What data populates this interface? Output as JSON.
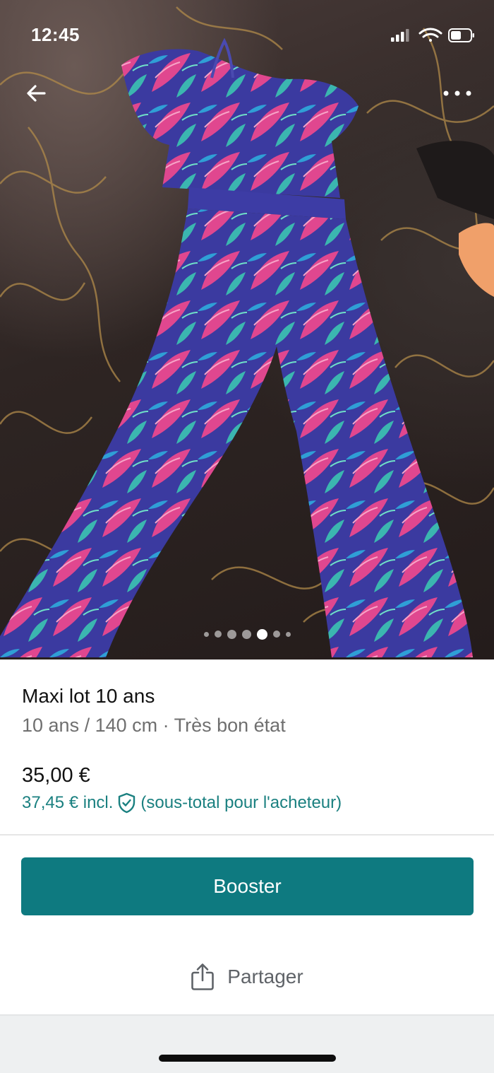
{
  "status_bar": {
    "time": "12:45",
    "icons": [
      "cellular-signal-icon",
      "wifi-icon",
      "battery-icon"
    ]
  },
  "nav": {
    "back_icon": "arrow-left-icon",
    "more_icon": "more-horizontal-icon"
  },
  "gallery": {
    "photo_count": 7,
    "active_index": 4
  },
  "item": {
    "title": "Maxi lot 10 ans",
    "subtitle": "10 ans / 140 cm · Très bon état",
    "price": "35,00 €",
    "price_incl_amount": "37,45 € incl.",
    "price_incl_note": "(sous-total pour l'acheteur)",
    "protection_icon": "shield-check-icon"
  },
  "actions": {
    "booster_label": "Booster",
    "share_label": "Partager",
    "share_icon": "share-icon"
  },
  "colors": {
    "accent": "#0e7a80",
    "link": "#1a8080",
    "muted_text": "#6f6f6f"
  }
}
